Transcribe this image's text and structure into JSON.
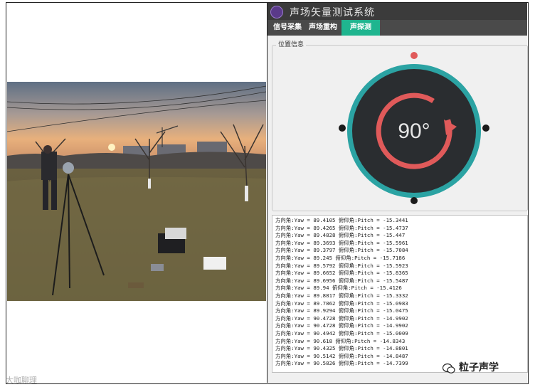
{
  "app": {
    "title": "声场矢量测试系统"
  },
  "tabs": [
    {
      "label": "信号采集",
      "active": false
    },
    {
      "label": "声场重构",
      "active": false
    },
    {
      "label": "声探测",
      "active": true
    }
  ],
  "position_panel": {
    "label": "位置信息",
    "angle_text": "90°"
  },
  "log": {
    "lines": [
      "方向角:Yaw = 89.4105 俯仰角:Pitch = -15.3441",
      "方向角:Yaw = 89.4265 俯仰角:Pitch = -15.4737",
      "方向角:Yaw = 89.4828 俯仰角:Pitch = -15.447",
      "方向角:Yaw = 89.3693 俯仰角:Pitch = -15.5961",
      "方向角:Yaw = 89.3797 俯仰角:Pitch = -15.7084",
      "方向角:Yaw = 89.245 俯仰角:Pitch = -15.7186",
      "方向角:Yaw = 89.5792 俯仰角:Pitch = -15.5923",
      "方向角:Yaw = 89.6652 俯仰角:Pitch = -15.8365",
      "方向角:Yaw = 89.6956 俯仰角:Pitch = -15.5487",
      "方向角:Yaw = 89.94 俯仰角:Pitch = -15.4126",
      "方向角:Yaw = 89.8817 俯仰角:Pitch = -15.3332",
      "方向角:Yaw = 89.7862 俯仰角:Pitch = -15.0983",
      "方向角:Yaw = 89.9294 俯仰角:Pitch = -15.0475",
      "方向角:Yaw = 90.4728 俯仰角:Pitch = -14.9902",
      "方向角:Yaw = 90.4728 俯仰角:Pitch = -14.9902",
      "方向角:Yaw = 90.4942 俯仰角:Pitch = -15.0009",
      "方向角:Yaw = 90.618 俯仰角:Pitch = -14.8343",
      "方向角:Yaw = 90.4325 俯仰角:Pitch = -14.8801",
      "方向角:Yaw = 90.5142 俯仰角:Pitch = -14.8487",
      "方向角:Yaw = 90.5826 俯仰角:Pitch = -14.7399"
    ]
  },
  "watermarks": {
    "left": "大咖聊理",
    "right": "粒子声学"
  },
  "colors": {
    "accent": "#1fb58f",
    "ring": "#2ba3a3",
    "dial": "#2a2d30",
    "pointer": "#e05a5a",
    "titlebar": "#3b3b3b"
  }
}
